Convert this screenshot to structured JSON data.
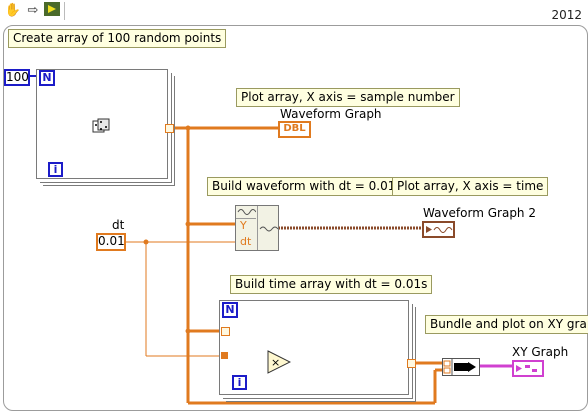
{
  "toolbar": {
    "tools": [
      "hand-tool-icon",
      "arrow-tool-icon",
      "run-icon"
    ]
  },
  "version": "2012",
  "notes": {
    "create_array": "Create array of 100 random points",
    "plot_array_sample": "Plot array, X axis = sample number",
    "build_waveform": "Build waveform with dt = 0.01s",
    "plot_array_time": "Plot array, X axis = time",
    "build_time_array": "Build time array with dt = 0.01s",
    "bundle_xy": "Bundle and plot on XY graph"
  },
  "controls": {
    "count_value": "100",
    "dt_label": "dt",
    "dt_value": "0.01"
  },
  "terminals": {
    "loop_count": "N",
    "loop_index": "i"
  },
  "indicators": {
    "waveform_graph": "Waveform Graph",
    "waveform_graph_type": "DBL",
    "waveform_graph_2": "Waveform Graph 2",
    "xy_graph": "XY Graph"
  },
  "build_waveform_node": {
    "y": "Y",
    "dt": "dt"
  },
  "colors": {
    "wire_orange": "#e07a1f",
    "wire_pink": "#d040d0",
    "wire_blue": "#1c1cc8",
    "wire_brown": "#8a4a2a"
  }
}
